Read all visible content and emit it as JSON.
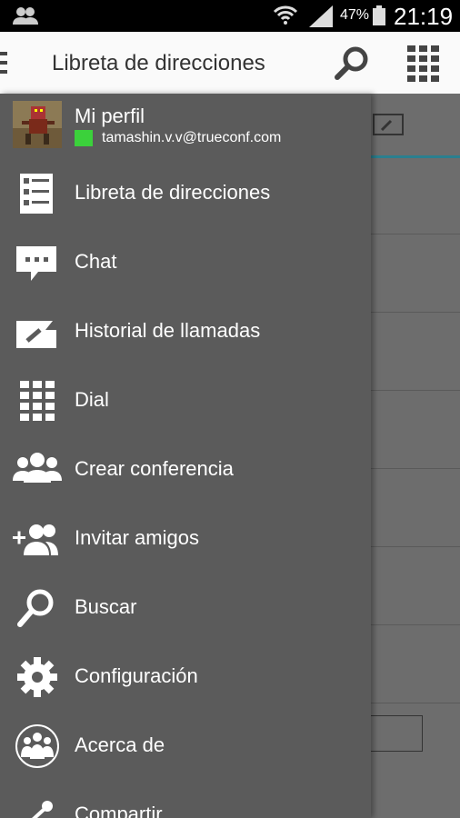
{
  "status_bar": {
    "battery_percent": "47%",
    "time": "21:19",
    "icons": [
      "contacts-notification-icon",
      "wifi-icon",
      "signal-icon",
      "battery-icon"
    ]
  },
  "action_bar": {
    "title": "Libreta de direcciones",
    "icons": [
      "menu-icon",
      "search-icon",
      "dial-grid-icon"
    ]
  },
  "drawer": {
    "profile": {
      "name": "Mi perfil",
      "email": "tamashin.v.v@trueconf.com",
      "status_color": "#3bd13b"
    },
    "items": [
      {
        "label": "Libreta de direcciones",
        "icon": "address-book-icon"
      },
      {
        "label": "Chat",
        "icon": "chat-icon"
      },
      {
        "label": "Historial de llamadas",
        "icon": "call-history-icon"
      },
      {
        "label": "Dial",
        "icon": "dial-grid-icon"
      },
      {
        "label": "Crear conferencia",
        "icon": "group-icon"
      },
      {
        "label": "Invitar amigos",
        "icon": "invite-friends-icon"
      },
      {
        "label": "Buscar",
        "icon": "search-icon"
      },
      {
        "label": "Configuración",
        "icon": "gear-icon"
      },
      {
        "label": "Acerca de",
        "icon": "about-icon"
      },
      {
        "label": "Compartir",
        "icon": "share-icon"
      }
    ]
  }
}
